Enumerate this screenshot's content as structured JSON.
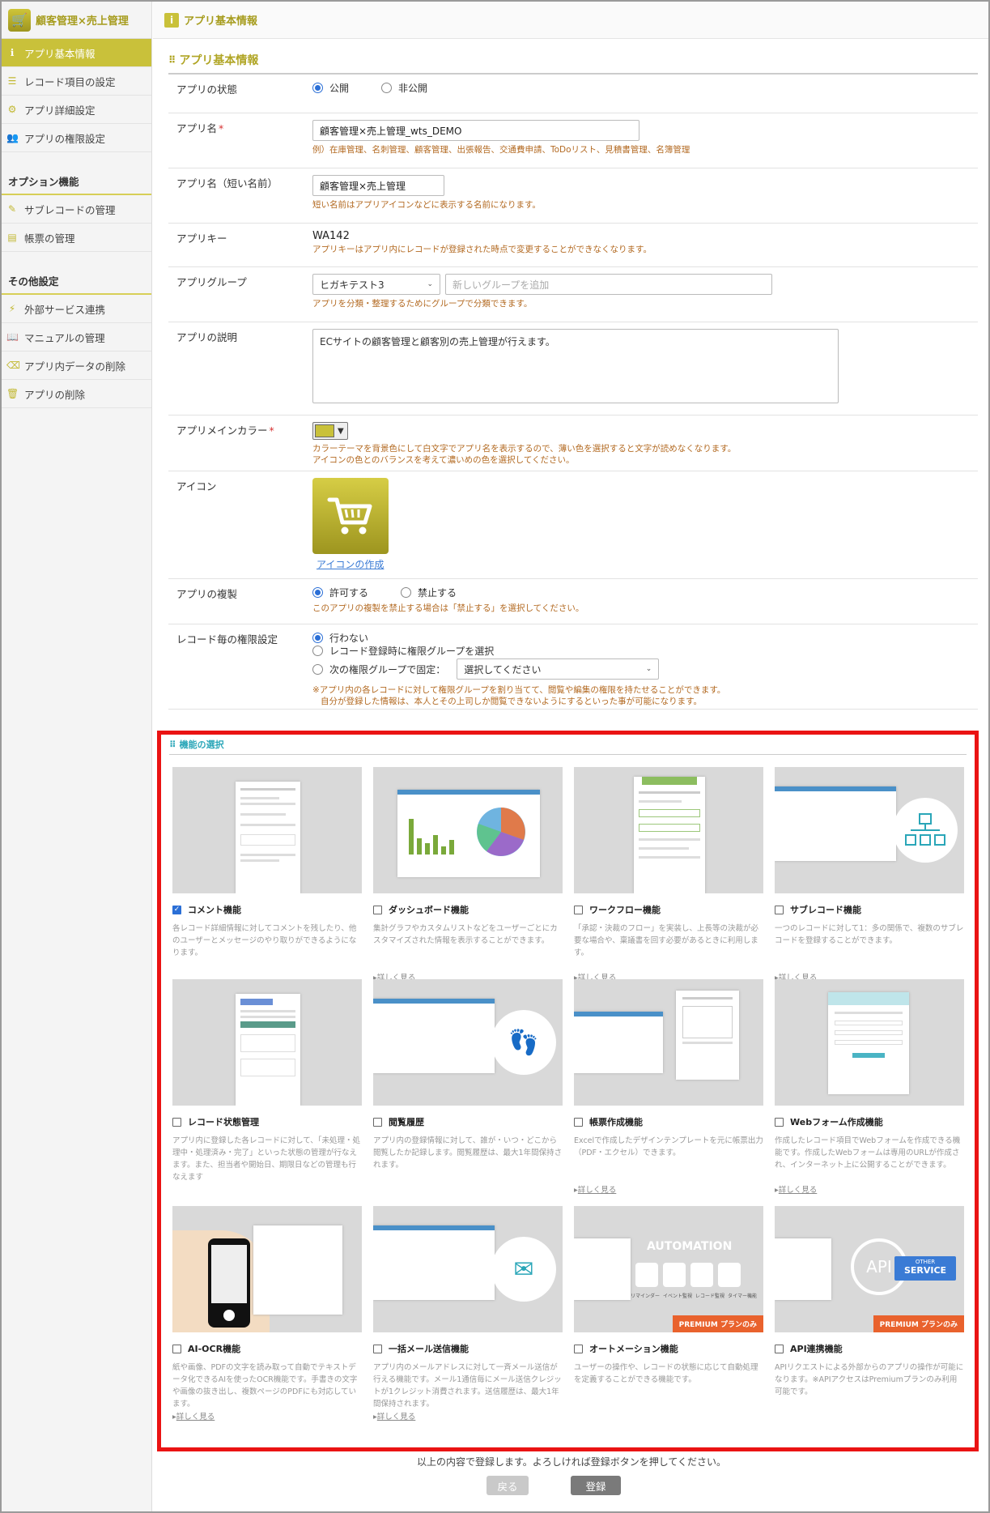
{
  "app": {
    "title": "顧客管理×売上管理"
  },
  "sidebar": {
    "items": [
      {
        "label": "アプリ基本情報",
        "icon": "info-icon"
      },
      {
        "label": "レコード項目の設定",
        "icon": "list-icon"
      },
      {
        "label": "アプリ詳細設定",
        "icon": "gear-icon"
      },
      {
        "label": "アプリの権限設定",
        "icon": "users-icon"
      }
    ],
    "option_title": "オプション機能",
    "option_items": [
      {
        "label": "サブレコードの管理",
        "icon": "subrecord-icon"
      },
      {
        "label": "帳票の管理",
        "icon": "document-icon"
      }
    ],
    "other_title": "その他設定",
    "other_items": [
      {
        "label": "外部サービス連携",
        "icon": "plug-icon"
      },
      {
        "label": "マニュアルの管理",
        "icon": "book-icon"
      },
      {
        "label": "アプリ内データの削除",
        "icon": "eraser-icon"
      },
      {
        "label": "アプリの削除",
        "icon": "trash-icon"
      }
    ]
  },
  "header": {
    "title": "アプリ基本情報"
  },
  "form": {
    "section_title": "アプリ基本情報",
    "status_label": "アプリの状態",
    "status_public": "公開",
    "status_private": "非公開",
    "name_label": "アプリ名",
    "name_value": "顧客管理×売上管理_wts_DEMO",
    "name_hint": "例）在庫管理、名刺管理、顧客管理、出張報告、交通費申請、ToDoリスト、見積書管理、名簿管理",
    "short_label": "アプリ名（短い名前）",
    "short_value": "顧客管理×売上管理",
    "short_hint": "短い名前はアプリアイコンなどに表示する名前になります。",
    "key_label": "アプリキー",
    "key_value": "WA142",
    "key_hint": "アプリキーはアプリ内にレコードが登録された時点で変更することができなくなります。",
    "group_label": "アプリグループ",
    "group_value": "ヒガキテスト3",
    "group_placeholder": "新しいグループを追加",
    "group_hint": "アプリを分類・整理するためにグループで分類できます。",
    "desc_label": "アプリの説明",
    "desc_value": "ECサイトの顧客管理と顧客別の売上管理が行えます。",
    "color_label": "アプリメインカラー",
    "color_hint1": "カラーテーマを背景色にして白文字でアプリ名を表示するので、薄い色を選択すると文字が読めなくなります。",
    "color_hint2": "アイコンの色とのバランスを考えて濃いめの色を選択してください。",
    "color_value": "#c9c13a",
    "icon_label": "アイコン",
    "icon_link": "アイコンの作成",
    "copy_label": "アプリの複製",
    "copy_allow": "許可する",
    "copy_deny": "禁止する",
    "copy_hint": "このアプリの複製を禁止する場合は「禁止する」を選択してください。",
    "perm_label": "レコード毎の権限設定",
    "perm_opt1": "行わない",
    "perm_opt2": "レコード登録時に権限グループを選択",
    "perm_opt3": "次の権限グループで固定：",
    "perm_select": "選択してください",
    "perm_hint1": "※アプリ内の各レコードに対して権限グループを割り当てて、閲覧や編集の権限を持たせることができます。",
    "perm_hint2": "自分が登録した情報は、本人とその上司しか閲覧できないようにするといった事が可能になります。"
  },
  "features": {
    "title": "機能の選択",
    "more_label": "詳しく見る",
    "premium_label": "PREMIUM プランのみ",
    "items": [
      {
        "name": "コメント機能",
        "checked": true,
        "desc": "各レコード詳細情報に対してコメントを残したり、他のユーザーとメッセージのやり取りができるようになります。",
        "more": false
      },
      {
        "name": "ダッシュボード機能",
        "checked": false,
        "desc": "集計グラフやカスタムリストなどをユーザーごとにカスタマイズされた情報を表示することができます。",
        "more": true
      },
      {
        "name": "ワークフロー機能",
        "checked": false,
        "desc": "「承認・決裁のフロー」を実装し、上長等の決裁が必要な場合や、稟議書を回す必要があるときに利用します。",
        "more": true
      },
      {
        "name": "サブレコード機能",
        "checked": false,
        "desc": "一つのレコードに対して1：多の関係で、複数のサブレコードを登録することができます。",
        "more": true
      },
      {
        "name": "レコード状態管理",
        "checked": false,
        "desc": "アプリ内に登録した各レコードに対して、「未処理・処理中・処理済み・完了」といった状態の管理が行なえます。また、担当者や開始日、期限日などの管理も行なえます",
        "more": false
      },
      {
        "name": "閲覧履歴",
        "checked": false,
        "desc": "アプリ内の登録情報に対して、誰が・いつ・どこから閲覧したか記録します。閲覧履歴は、最大1年間保持されます。",
        "more": false
      },
      {
        "name": "帳票作成機能",
        "checked": false,
        "desc": "Excelで作成したデザインテンプレートを元に帳票出力（PDF・エクセル）できます。",
        "more": true
      },
      {
        "name": "Webフォーム作成機能",
        "checked": false,
        "desc": "作成したレコード項目でWebフォームを作成できる機能です。作成したWebフォームは専用のURLが作成され、インターネット上に公開することができます。",
        "more": true
      },
      {
        "name": "AI-OCR機能",
        "checked": false,
        "desc": "紙や画像、PDFの文字を読み取って自動でテキストデータ化できるAIを使ったOCR機能です。手書きの文字や画像の抜き出し、複数ページのPDFにも対応しています。",
        "more": true
      },
      {
        "name": "一括メール送信機能",
        "checked": false,
        "desc": "アプリ内のメールアドレスに対して一斉メール送信が行える機能です。メール1通信毎にメール送信クレジットが1クレジット消費されます。送信履歴は、最大1年間保持されます。",
        "more": true
      },
      {
        "name": "オートメーション機能",
        "checked": false,
        "desc": "ユーザーの操作や、レコードの状態に応じて自動処理を定義することができる機能です。",
        "more": false,
        "premium": true
      },
      {
        "name": "API連携機能",
        "checked": false,
        "desc": "APIリクエストによる外部からのアプリの操作が可能になります。※APIアクセスはPremiumプランのみ利用可能です。",
        "more": false,
        "premium": true
      }
    ],
    "thumb_labels": {
      "automation": "AUTOMATION",
      "auto_items": [
        "リマインダー",
        "イベント監視",
        "レコード監視",
        "タイマー機能"
      ],
      "api": "API",
      "other": "OTHER",
      "service": "SERVICE"
    }
  },
  "footer": {
    "note": "以上の内容で登録します。よろしければ登録ボタンを押してください。",
    "back": "戻る",
    "register": "登録"
  }
}
